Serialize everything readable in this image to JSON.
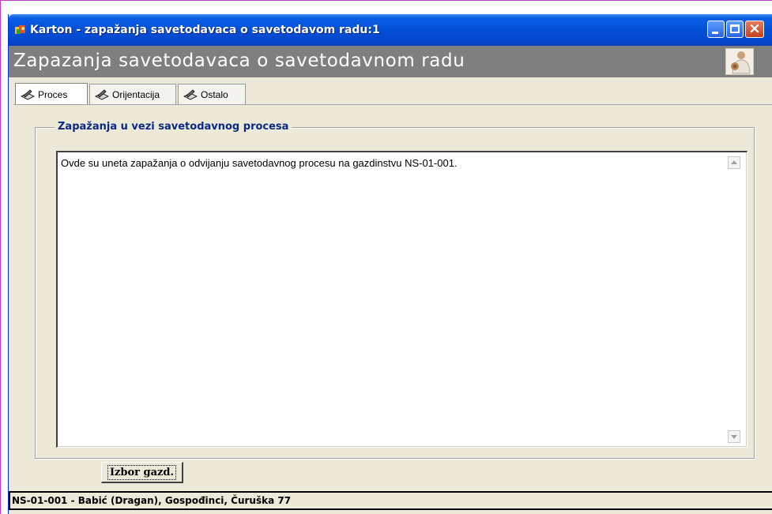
{
  "window": {
    "title": "Karton - zapažanja savetodavaca o savetodavom radu:1"
  },
  "header": {
    "title": "Zapazanja savetodavaca o savetodavnom radu"
  },
  "tabs": [
    {
      "label": "Proces",
      "active": true
    },
    {
      "label": "Orijentacija",
      "active": false
    },
    {
      "label": "Ostalo",
      "active": false
    }
  ],
  "group": {
    "label": "Zapažanja u vezi savetodavnog procesa"
  },
  "memo": {
    "text": "Ovde su uneta zapažanja o odvijanju savetodavnog procesu na gazdinstvu NS-01-001."
  },
  "buttons": {
    "select_farm": "Izbor gazd."
  },
  "status": {
    "text": "NS-01-001 - Babić (Dragan), Gospođinci, Čuruška 77"
  },
  "colors": {
    "titlebar": "#0550d8",
    "header_band": "#7f7f7f",
    "group_label": "#0b2a88",
    "window_bg": "#ece9d8"
  },
  "icons": {
    "app": "karton-app-icon",
    "tab": "notebook-pencil-icon",
    "header": "advisor-logo-icon"
  }
}
